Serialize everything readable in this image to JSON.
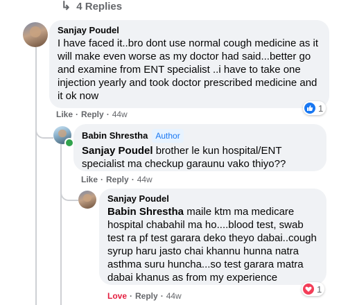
{
  "replies_link": {
    "label": "4 Replies",
    "icon": "reply-arrow-icon"
  },
  "comment": {
    "author": "Sanjay Poudel",
    "text": "I have faced it..bro dont use normal cough medicine as it will make even worse as my doctor had said...better go and examine from ENT specialist ..i have to take one injection yearly and took doctor prescribed medicine and it ok now",
    "actions": {
      "like": "Like",
      "reply": "Reply",
      "time": "44w"
    },
    "reaction": {
      "type": "like",
      "icon": "like-reaction-icon",
      "color": "#1877f2",
      "count": "1"
    }
  },
  "reply1": {
    "author": "Babin Shrestha",
    "badge": "Author",
    "mention": "Sanjay Poudel",
    "text": "brother le kun hospital/ENT specialist ma checkup garaunu vako thiyo??",
    "actions": {
      "like": "Like",
      "reply": "Reply",
      "time": "44w"
    }
  },
  "reply2": {
    "author": "Sanjay Poudel",
    "mention": "Babin Shrestha",
    "text": "maile ktm ma medicare hospital chabahil ma ho....blood test, swab test ra pf test garara deko theyo dabai..cough syrup haru jasto chai khannu hunna natra asthma suru huncha...so test garara matra dabai khanus as from my experience",
    "actions": {
      "love": "Love",
      "reply": "Reply",
      "time": "44w"
    },
    "reaction": {
      "type": "love",
      "icon": "love-reaction-icon",
      "color": "#f33e58",
      "count": "1"
    }
  },
  "colors": {
    "bubble": "#f0f2f5",
    "meta": "#65676b",
    "love": "#e41e3f",
    "badge_text": "#1877f2",
    "online": "#31a24c"
  }
}
